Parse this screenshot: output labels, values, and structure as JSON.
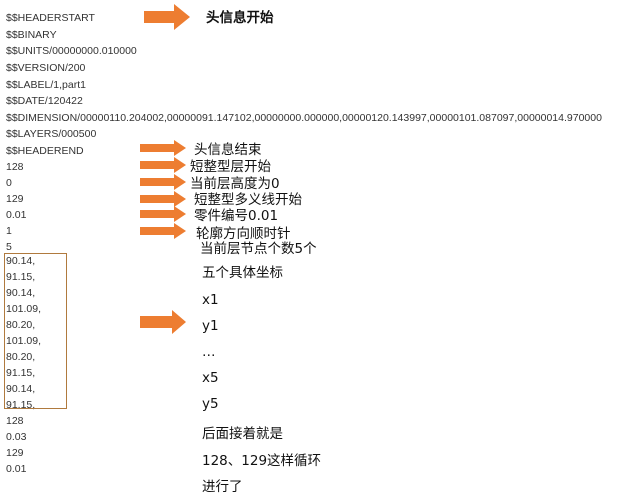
{
  "file_lines": [
    "$$HEADERSTART",
    "$$BINARY",
    "$$UNITS/00000000.010000",
    "$$VERSION/200",
    "$$LABEL/1,part1",
    "$$DATE/120422",
    "$$DIMENSION/00000110.204002,00000091.147102,00000000.000000,00000120.143997,00000101.087097,00000014.970000",
    "$$LAYERS/000500",
    "$$HEADEREND",
    "128",
    "0",
    "129",
    "0.01",
    "1",
    "5",
    "90.14,",
    "91.15,",
    "90.14,",
    "101.09,",
    "80.20,",
    "101.09,",
    "80.20,",
    "91.15,",
    "90.14,",
    "91.15,",
    "128",
    "0.03",
    "129",
    "0.01"
  ],
  "annotations": {
    "header_start": "头信息开始",
    "header_end": "头信息结束",
    "short_layer_start": "短整型层开始",
    "layer_height": "当前层高度为0",
    "polyline_start": "短整型多义线开始",
    "part_number": "零件编号0.01",
    "clockwise": "轮廓方向顺时针",
    "node_count": "当前层节点个数5个",
    "coords_title": "五个具体坐标",
    "x1": "x1",
    "y1": "y1",
    "ellipsis": "…",
    "x5": "x5",
    "y5": "y5",
    "followed_by": "后面接着就是",
    "loop": "128、129这样循环",
    "proceed": "进行了"
  },
  "colors": {
    "arrow": "#ed7d31",
    "box_border": "#b07a3e"
  },
  "icons": {
    "arrow": "right-arrow-icon"
  }
}
